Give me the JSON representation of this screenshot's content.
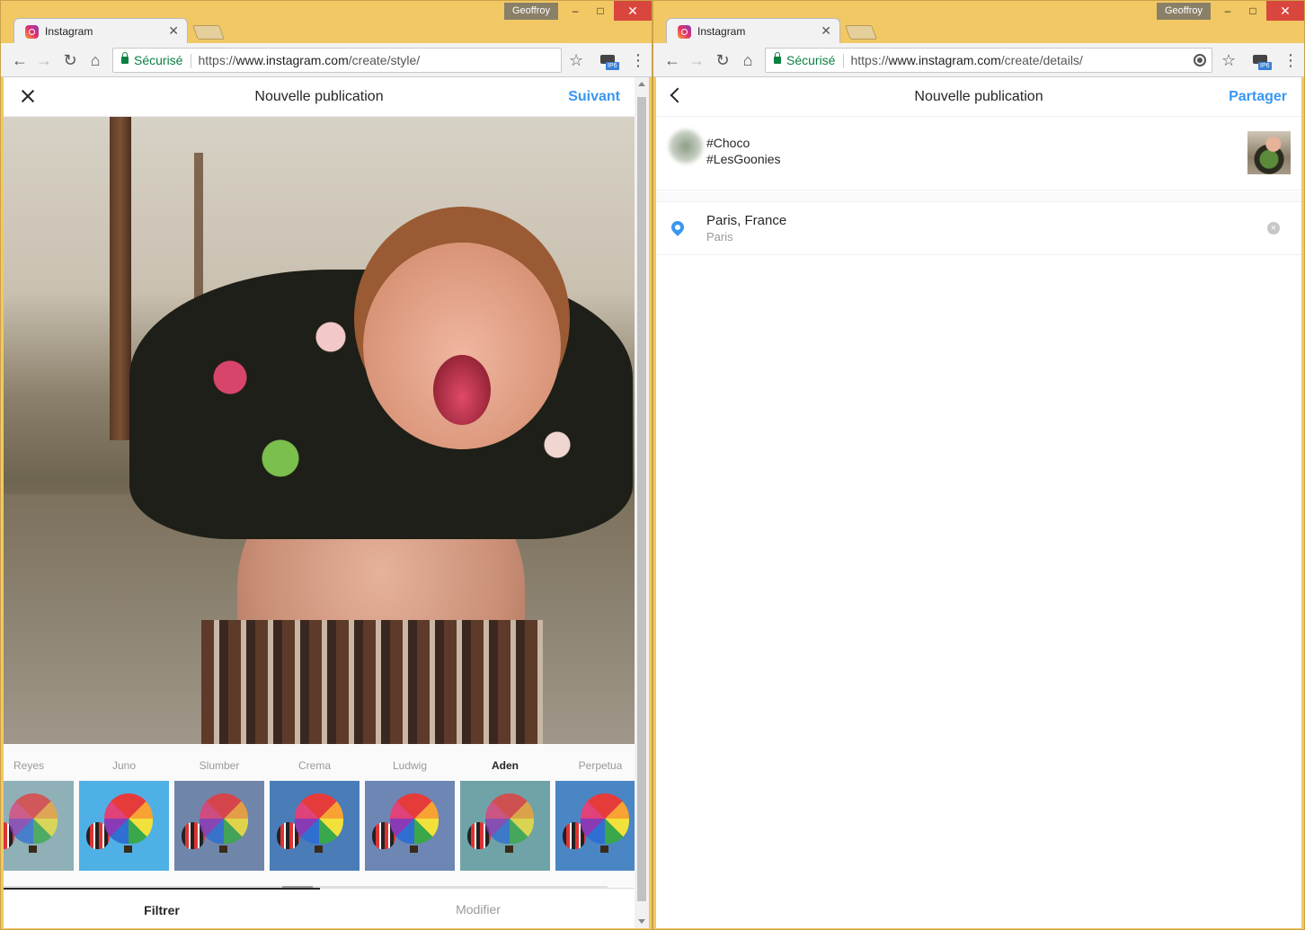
{
  "left_window": {
    "profile": "Geoffroy",
    "tab_title": "Instagram",
    "url_secure": "Sécurisé",
    "url_prefix": "https://",
    "url_host": "www.instagram.com",
    "url_path": "/create/style/",
    "header_title": "Nouvelle publication",
    "header_action": "Suivant",
    "filters": [
      {
        "name": "Reyes",
        "active": false
      },
      {
        "name": "Juno",
        "active": false
      },
      {
        "name": "Slumber",
        "active": false
      },
      {
        "name": "Crema",
        "active": false
      },
      {
        "name": "Ludwig",
        "active": false
      },
      {
        "name": "Aden",
        "active": true
      },
      {
        "name": "Perpetua",
        "active": false
      }
    ],
    "tabs": {
      "filter": "Filtrer",
      "edit": "Modifier"
    }
  },
  "right_window": {
    "profile": "Geoffroy",
    "tab_title": "Instagram",
    "url_secure": "Sécurisé",
    "url_prefix": "https://",
    "url_host": "www.instagram.com",
    "url_path": "/create/details/",
    "header_title": "Nouvelle publication",
    "header_action": "Partager",
    "caption_line1": "#Choco",
    "caption_line2": "#LesGoonies",
    "location_name": "Paris, France",
    "location_sub": "Paris"
  },
  "badge_text": "IP6",
  "window_controls": {
    "minimize": "–",
    "maximize": "□",
    "close": "✕"
  },
  "colors": {
    "accent": "#3897f0",
    "frame": "#f2c864",
    "secure": "#0b8043"
  }
}
